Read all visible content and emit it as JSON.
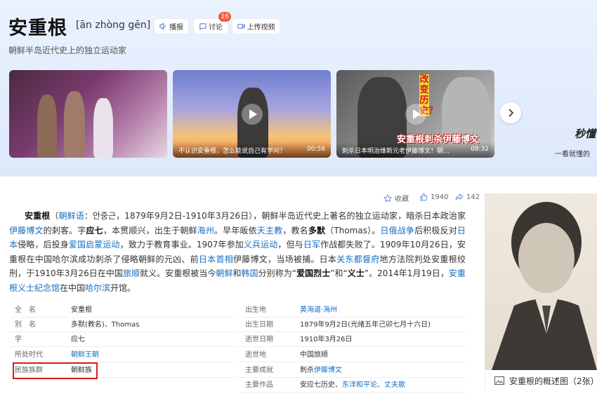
{
  "header": {
    "title": "安重根",
    "pinyin": "[ān zhòng gēn]",
    "subtitle": "朝鲜半岛近代史上的独立运动家",
    "buttons": {
      "audio": "播报",
      "discuss": "讨论",
      "discuss_badge": "16",
      "upload": "上传视频"
    }
  },
  "videos": [
    {
      "title": "",
      "duration": ""
    },
    {
      "title": "不认识安重根，怎么能说自己有学问？",
      "duration": "00:58"
    },
    {
      "title": "刺杀日本明治维新元老伊藤博文！朝…",
      "duration": "08:32"
    }
  ],
  "video_overlays": {
    "v3_vertical": "改变历史？",
    "v3_banner": "安重根刺杀伊藤博文"
  },
  "brand": {
    "line1": "秒懂",
    "line2": "一看就懂的"
  },
  "stats": {
    "favorite": "收藏",
    "likes": "1940",
    "shares": "142"
  },
  "summary": [
    {
      "t": "安重根",
      "s": "b"
    },
    {
      "t": "（"
    },
    {
      "t": "朝鲜语",
      "s": "lk"
    },
    {
      "t": "：안중근，1879年9月2日-1910年3月26日），朝鲜半岛近代史上著名的独立运动家，暗杀日本政治家"
    },
    {
      "t": "伊藤博文",
      "s": "lk"
    },
    {
      "t": "的刺客。字"
    },
    {
      "t": "应七",
      "s": "b"
    },
    {
      "t": "，本贯顺兴，出生于朝鲜"
    },
    {
      "t": "海州",
      "s": "lk"
    },
    {
      "t": "。早年皈依"
    },
    {
      "t": "天主教",
      "s": "lk"
    },
    {
      "t": "，教名"
    },
    {
      "t": "多默",
      "s": "b"
    },
    {
      "t": "（Thomas）。"
    },
    {
      "t": "日俄战争",
      "s": "lk"
    },
    {
      "t": "后积极反对"
    },
    {
      "t": "日本",
      "s": "lk"
    },
    {
      "t": "侵略，后投身"
    },
    {
      "t": "爱国启蒙运动",
      "s": "lk"
    },
    {
      "t": "，致力于教育事业。1907年参加"
    },
    {
      "t": "义兵运动",
      "s": "lk"
    },
    {
      "t": "，但与"
    },
    {
      "t": "日军",
      "s": "lk"
    },
    {
      "t": "作战都失败了。1909年10月26日，安重根在中国哈尔滨成功刺杀了侵略朝鲜的元凶、前"
    },
    {
      "t": "日本首相",
      "s": "lk"
    },
    {
      "t": "伊藤博文，当场被捕。日本"
    },
    {
      "t": "关东都督府",
      "s": "lk"
    },
    {
      "t": "地方法院判处安重根绞刑，于1910年3月26日在中国"
    },
    {
      "t": "旅顺",
      "s": "lk"
    },
    {
      "t": "就义。安重根被当今"
    },
    {
      "t": "朝鲜",
      "s": "lk"
    },
    {
      "t": "和"
    },
    {
      "t": "韩国",
      "s": "lk"
    },
    {
      "t": "分别称为“"
    },
    {
      "t": "爱国烈士",
      "s": "b"
    },
    {
      "t": "”和“"
    },
    {
      "t": "义士",
      "s": "b"
    },
    {
      "t": "”。2014年1月19日，"
    },
    {
      "t": "安重根义士纪念馆",
      "s": "lk"
    },
    {
      "t": "在中国"
    },
    {
      "t": "哈尔滨",
      "s": "lk"
    },
    {
      "t": "开馆。"
    }
  ],
  "basic_info": {
    "left": [
      {
        "key": "全　名",
        "value": "安重根",
        "link": false
      },
      {
        "key": "别　名",
        "value": "多默(教名)、Thomas",
        "link": false
      },
      {
        "key": "字",
        "value": "应七",
        "link": false
      },
      {
        "key": "所处时代",
        "value": "朝鲜王朝",
        "link": true
      },
      {
        "key": "民族族群",
        "value": "朝鲜族",
        "link": false
      }
    ],
    "right": [
      {
        "key": "出生地",
        "value": "黄海道·海州",
        "link": true
      },
      {
        "key": "出生日期",
        "value": "1879年9月2日(光绪五年己卯七月十六日)",
        "link": false
      },
      {
        "key": "逝世日期",
        "value": "1910年3月26日",
        "link": false
      },
      {
        "key": "逝世地",
        "value": "中国旅顺",
        "link": false
      },
      {
        "key": "主要成就",
        "value_parts": [
          {
            "t": "刺杀"
          },
          {
            "t": "伊藤博文",
            "s": "lk"
          }
        ]
      },
      {
        "key": "主要作品",
        "value_parts": [
          {
            "t": "安应七历史、"
          },
          {
            "t": "东洋和平论",
            "s": "lk"
          },
          {
            "t": "、"
          },
          {
            "t": "丈夫歌",
            "s": "lk"
          }
        ]
      }
    ]
  },
  "portrait_caption": "安重根的概述图（2张）",
  "colors": {
    "link": "#136ec2",
    "highlight": "#d81e1e",
    "badge": "#f25b46"
  }
}
